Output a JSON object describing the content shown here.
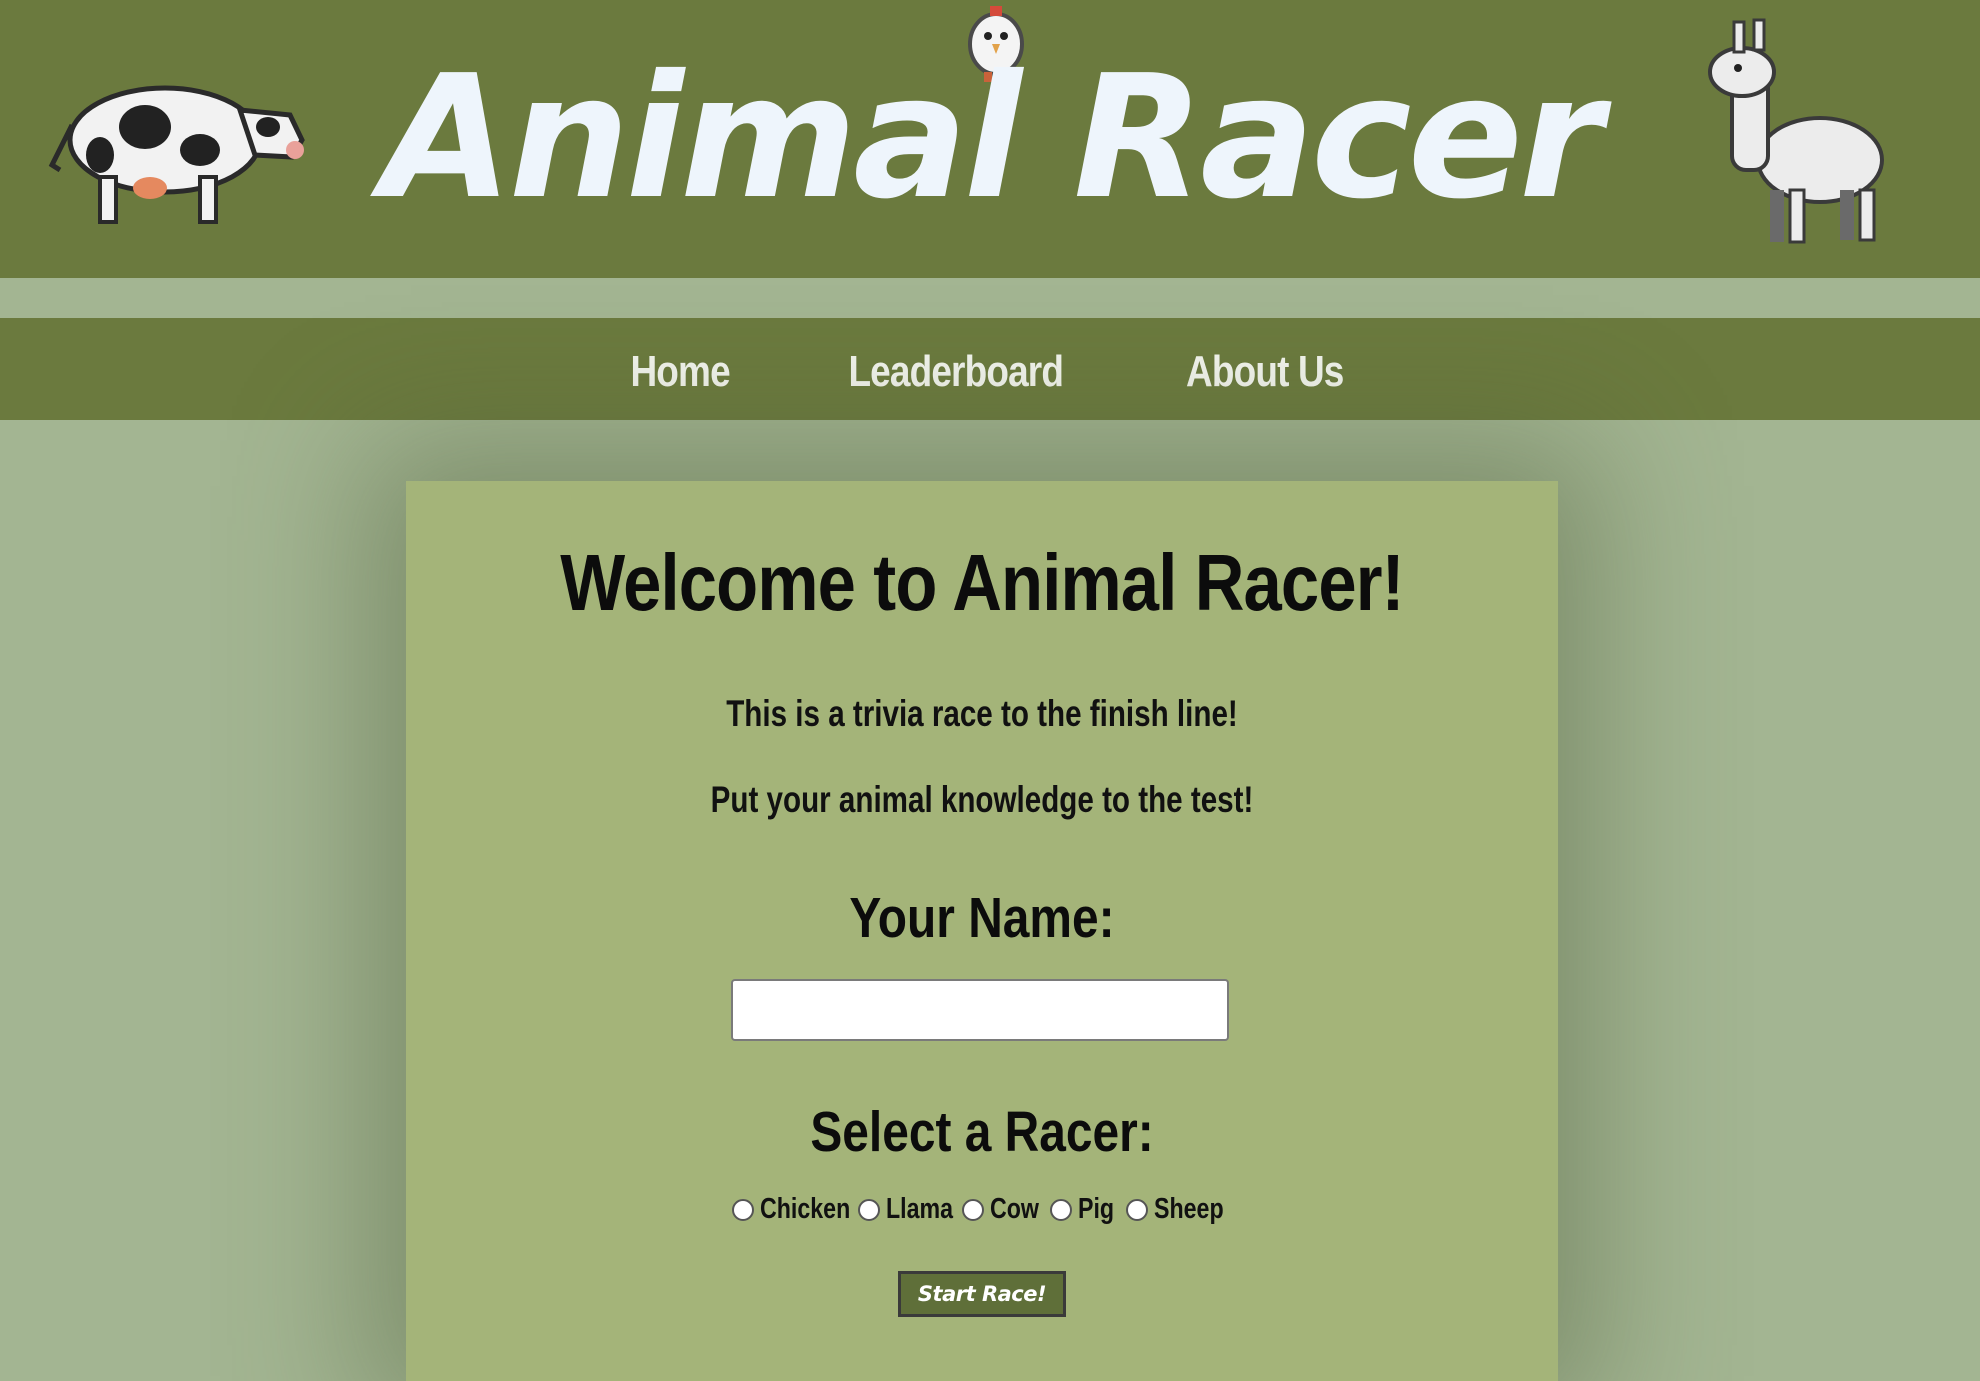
{
  "header": {
    "title": "Animal Racer",
    "sprites": {
      "left": "cow-sprite",
      "center": "chicken-sprite",
      "right": "llama-sprite"
    }
  },
  "nav": {
    "items": [
      {
        "label": "Home"
      },
      {
        "label": "Leaderboard"
      },
      {
        "label": "About Us"
      }
    ]
  },
  "main": {
    "heading": "Welcome to Animal Racer!",
    "intro_line_1": "This is a trivia race to the finish line!",
    "intro_line_2": "Put your animal knowledge to the test!",
    "name_label": "Your Name:",
    "name_value": "",
    "racer_label": "Select a Racer:",
    "racers": [
      {
        "label": "Chicken",
        "selected": false
      },
      {
        "label": "Llama",
        "selected": false
      },
      {
        "label": "Cow",
        "selected": false
      },
      {
        "label": "Pig",
        "selected": false
      },
      {
        "label": "Sheep",
        "selected": false
      }
    ],
    "start_button": "Start Race!"
  },
  "colors": {
    "banner": "#6b7a3e",
    "page_background": "#a3b592",
    "card_background": "#a4b479",
    "title_text": "#eef5fc",
    "button_background": "#5f6f39"
  }
}
